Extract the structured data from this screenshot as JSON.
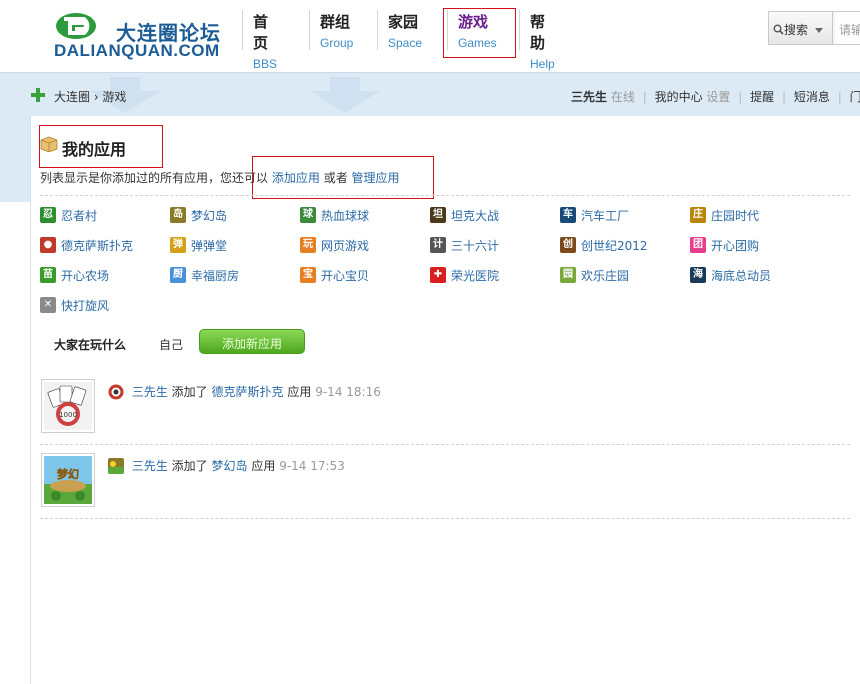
{
  "header": {
    "logo_cn": "大连圈论坛",
    "logo_en": "DALIANQUAN.COM",
    "nav": [
      {
        "cn": "首页",
        "en": "BBS",
        "active": false
      },
      {
        "cn": "群组",
        "en": "Group",
        "active": false
      },
      {
        "cn": "家园",
        "en": "Space",
        "active": false
      },
      {
        "cn": "游戏",
        "en": "Games",
        "active": true
      },
      {
        "cn": "帮助",
        "en": "Help",
        "active": false
      }
    ],
    "search_label": "搜索",
    "search_placeholder": "请输"
  },
  "subbar": {
    "breadcrumb": "大连圈 › 游戏",
    "username": "三先生",
    "status": "在线",
    "my_center": "我的中心",
    "settings": "设置",
    "remind": "提醒",
    "messages": "短消息",
    "portal": "门户"
  },
  "main": {
    "title": "我的应用",
    "desc_prefix": "列表显示是你添加过的所有应用，您还可以",
    "add_app_link": "添加应用",
    "or": "或者",
    "manage_app_link": "管理应用",
    "apps": [
      {
        "name": "忍者村",
        "icon": "ninja-icon",
        "color": "#2f8f2f"
      },
      {
        "name": "梦幻岛",
        "icon": "island-icon",
        "color": "#8a7a2a"
      },
      {
        "name": "热血球球",
        "icon": "ball-icon",
        "color": "#3d8a3d"
      },
      {
        "name": "坦克大战",
        "icon": "tank-icon",
        "color": "#4a3a1a"
      },
      {
        "name": "汽车工厂",
        "icon": "car-factory-icon",
        "color": "#1a4a7a"
      },
      {
        "name": "庄园时代",
        "icon": "manor-icon",
        "color": "#b8860b"
      },
      {
        "name": "德克萨斯扑克",
        "icon": "poker-chip-icon",
        "color": "#c0392b"
      },
      {
        "name": "弹弹堂",
        "icon": "ddt-icon",
        "color": "#d4a017"
      },
      {
        "name": "网页游戏",
        "icon": "webgame-icon",
        "color": "#e67e22"
      },
      {
        "name": "三十六计",
        "icon": "strategy-icon",
        "color": "#555555"
      },
      {
        "name": "创世纪2012",
        "icon": "genesis-icon",
        "color": "#7a4a1a"
      },
      {
        "name": "开心团购",
        "icon": "groupbuy-icon",
        "color": "#e63e8a"
      },
      {
        "name": "开心农场",
        "icon": "sprout-icon",
        "color": "#3a9a2a"
      },
      {
        "name": "幸福厨房",
        "icon": "kitchen-icon",
        "color": "#4a90d9"
      },
      {
        "name": "开心宝贝",
        "icon": "baby-icon",
        "color": "#e67e22"
      },
      {
        "name": "荣光医院",
        "icon": "hospital-cross-icon",
        "color": "#d81e1e"
      },
      {
        "name": "欢乐庄园",
        "icon": "farm-icon",
        "color": "#7aa83a"
      },
      {
        "name": "海底总动员",
        "icon": "ocean-icon",
        "color": "#1a3a5a"
      },
      {
        "name": "快打旋风",
        "icon": "swords-icon",
        "color": "#8a8a8a"
      }
    ],
    "tabs": {
      "everyone": "大家在玩什么",
      "self": "自己",
      "add_new": "添加新应用"
    },
    "feed": [
      {
        "user": "三先生",
        "action": "添加了",
        "app": "德克萨斯扑克",
        "suffix": "应用",
        "time": "9-14 18:16"
      },
      {
        "user": "三先生",
        "action": "添加了",
        "app": "梦幻岛",
        "suffix": "应用",
        "time": "9-14 17:53"
      }
    ]
  }
}
